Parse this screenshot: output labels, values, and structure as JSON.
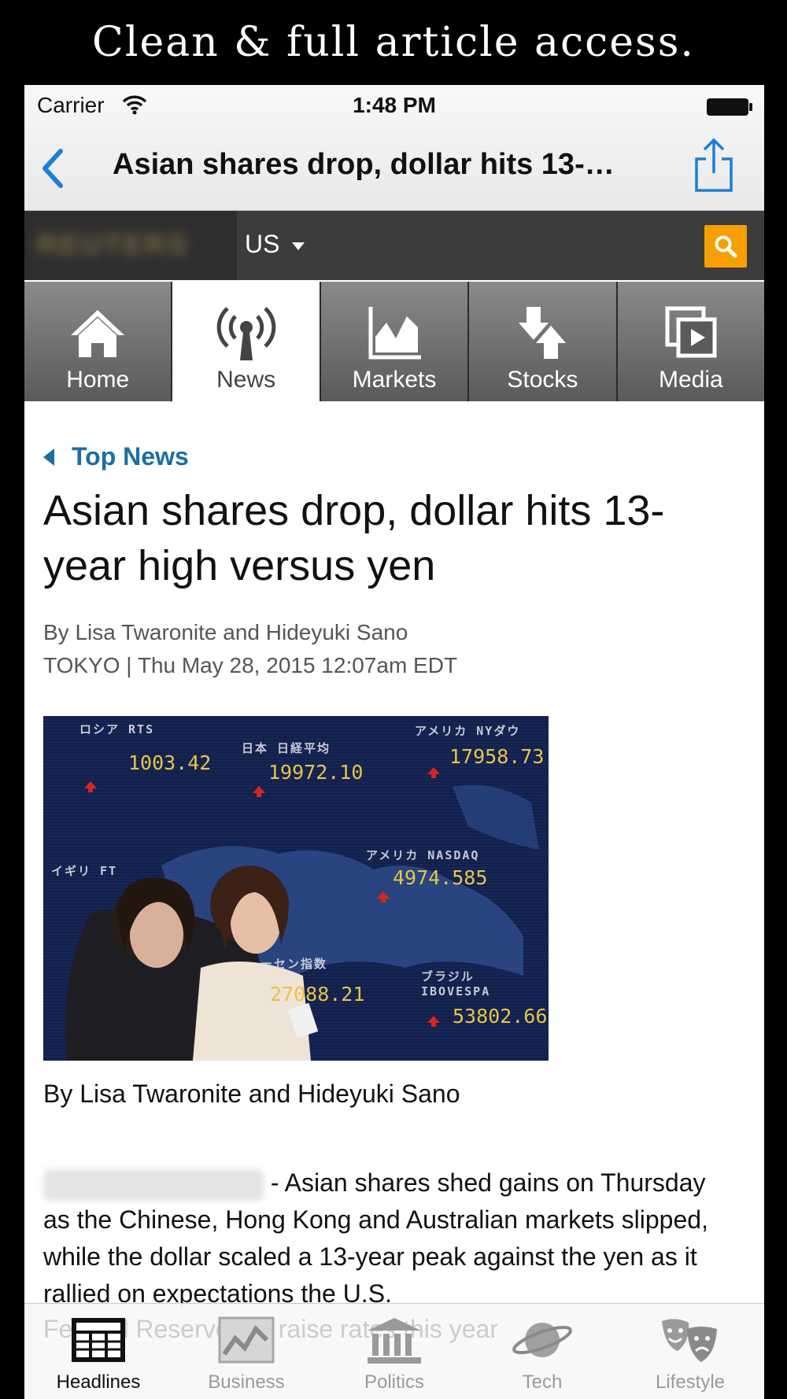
{
  "promo": {
    "caption": "Clean & full article access."
  },
  "status_bar": {
    "carrier": "Carrier",
    "time": "1:48 PM"
  },
  "nav_bar": {
    "title": "Asian shares drop, dollar hits 13-…"
  },
  "site_header": {
    "logo_text": "REUTERS",
    "edition": "US"
  },
  "section_tabs": [
    {
      "label": "Home",
      "icon": "home-icon",
      "active": false
    },
    {
      "label": "News",
      "icon": "broadcast-icon",
      "active": true
    },
    {
      "label": "Markets",
      "icon": "chart-icon",
      "active": false
    },
    {
      "label": "Stocks",
      "icon": "arrows-icon",
      "active": false
    },
    {
      "label": "Media",
      "icon": "media-icon",
      "active": false
    }
  ],
  "article": {
    "section": "Top News",
    "headline": "Asian shares drop, dollar hits 13-year high versus yen",
    "byline": "By Lisa Twaronite and Hideyuki Sano",
    "dateline": "TOKYO | Thu May 28, 2015 12:07am EDT",
    "caption": "By Lisa Twaronite and Hideyuki Sano",
    "body": "- Asian shares shed gains on Thursday as the Chinese, Hong Kong and Australian markets slipped, while the dollar scaled a 13-year peak against the yen as it rallied on expectations the U.S.",
    "body_overflow": "Federal Reserve will raise rates this year",
    "photo_board": [
      {
        "label": "ロシア RTS",
        "value": "1003.42"
      },
      {
        "label": "日本 日経平均",
        "value": "19972.10"
      },
      {
        "label": "アメリカ NYダウ",
        "value": "17958.73"
      },
      {
        "label": "アメリカ NASDAQ",
        "value": "4974.585"
      },
      {
        "label": "ーセン指数",
        "value": "27088.21"
      },
      {
        "label": "ブラジル IBOVESPA",
        "value": "53802.66"
      },
      {
        "label": "イギリ FT",
        "value": ""
      }
    ]
  },
  "tab_bar": [
    {
      "label": "Headlines",
      "icon": "newspaper-icon",
      "active": true
    },
    {
      "label": "Business",
      "icon": "business-chart-icon",
      "active": false
    },
    {
      "label": "Politics",
      "icon": "capitol-icon",
      "active": false
    },
    {
      "label": "Tech",
      "icon": "planet-icon",
      "active": false
    },
    {
      "label": "Lifestyle",
      "icon": "theater-masks-icon",
      "active": false
    }
  ],
  "colors": {
    "accent_blue": "#1a7fd6",
    "section_blue": "#1a6fa0",
    "search_orange": "#f5a000"
  }
}
